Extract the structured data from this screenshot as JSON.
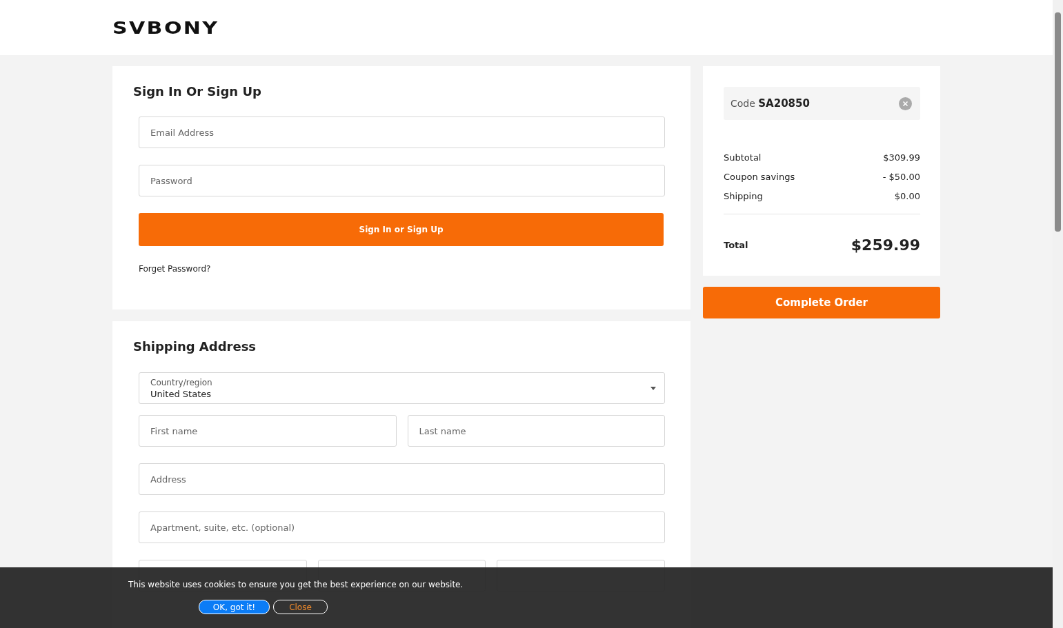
{
  "logo": "SVBONY",
  "sign_in": {
    "title": "Sign In Or Sign Up",
    "fields": [
      {
        "placeholder": "Email Address"
      },
      {
        "placeholder": "Password"
      }
    ],
    "button": "Sign In or Sign Up",
    "forgot_link": "Forget Password?"
  },
  "shipping": {
    "title": "Shipping Address",
    "country": {
      "label": "Country/region",
      "value": "United States"
    },
    "first_name": {
      "placeholder": "First name"
    },
    "last_name": {
      "placeholder": "Last name"
    },
    "address": {
      "placeholder": "Address"
    },
    "apartment": {
      "placeholder": "Apartment, suite, etc. (optional)"
    }
  },
  "summary": {
    "coupon": {
      "label": "Code",
      "code": "SA20850"
    },
    "lines": [
      {
        "label": "Subtotal",
        "value": "$309.99"
      },
      {
        "label": "Coupon savings",
        "value": "- $50.00"
      },
      {
        "label": "Shipping",
        "value": "$0.00"
      }
    ],
    "total": {
      "label": "Total",
      "value": "$259.99"
    }
  },
  "complete_button": "Complete Order",
  "cookie_banner": {
    "message": "This website uses cookies to ensure you get the best experience on our website.",
    "accept": "OK, got it!",
    "close": "Close"
  }
}
